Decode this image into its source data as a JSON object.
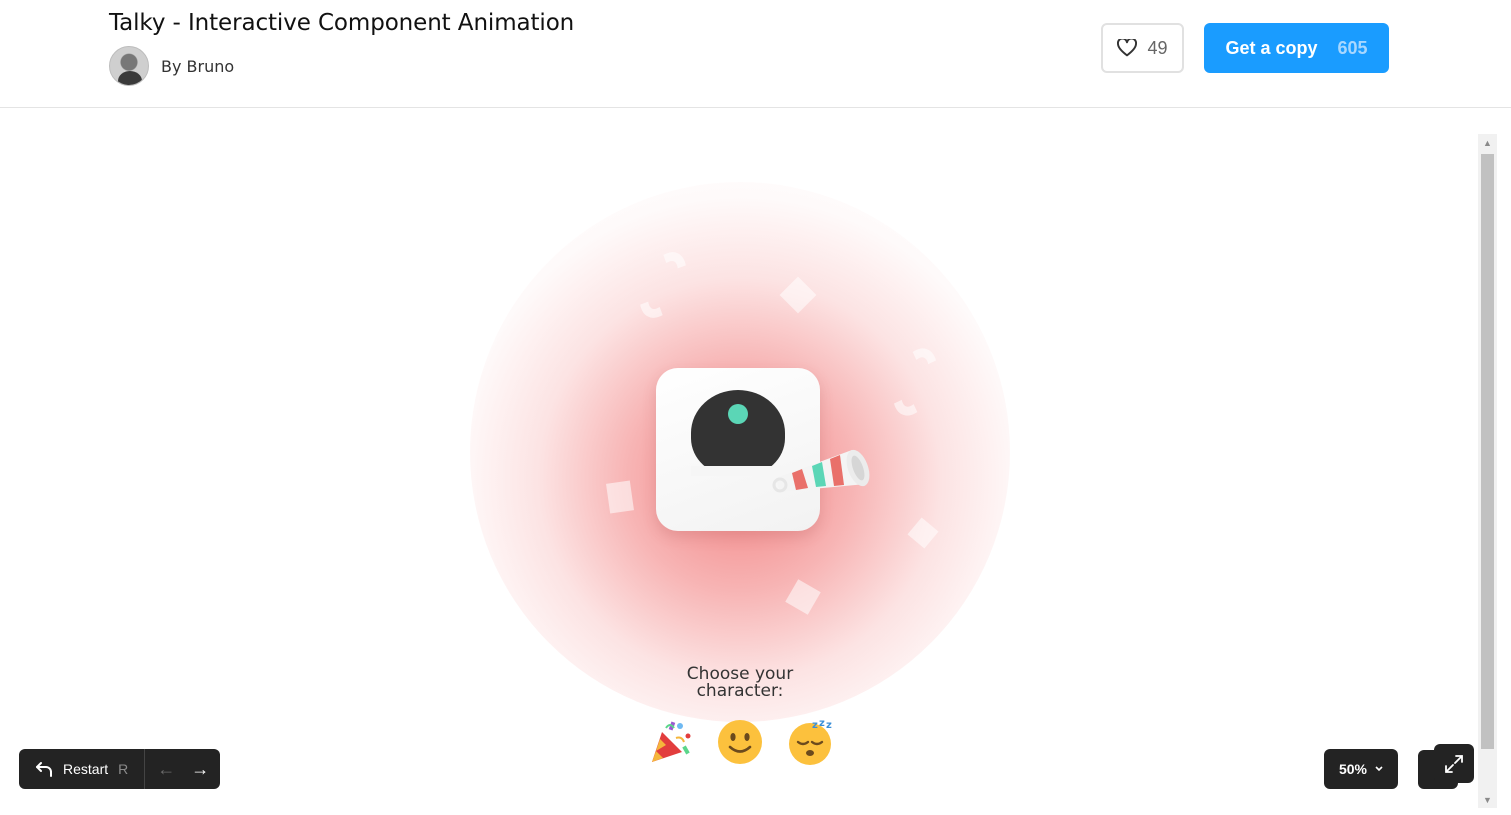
{
  "header": {
    "title": "Talky - Interactive Component Animation",
    "author": "By Bruno",
    "likes": "49",
    "copy_label": "Get a copy",
    "copy_count": "605"
  },
  "canvas": {
    "prompt_line1": "Choose your",
    "prompt_line2": "character:",
    "characters": [
      "party-popper",
      "smiling-face",
      "sleeping-face"
    ]
  },
  "controls": {
    "restart_label": "Restart",
    "restart_key": "R",
    "prev_arrow": "←",
    "next_arrow": "→",
    "zoom": "50%"
  },
  "colors": {
    "accent": "#1a9cff",
    "glow": "#f06e6e",
    "eye": "#5bd6b6",
    "control_bg": "#232323"
  }
}
